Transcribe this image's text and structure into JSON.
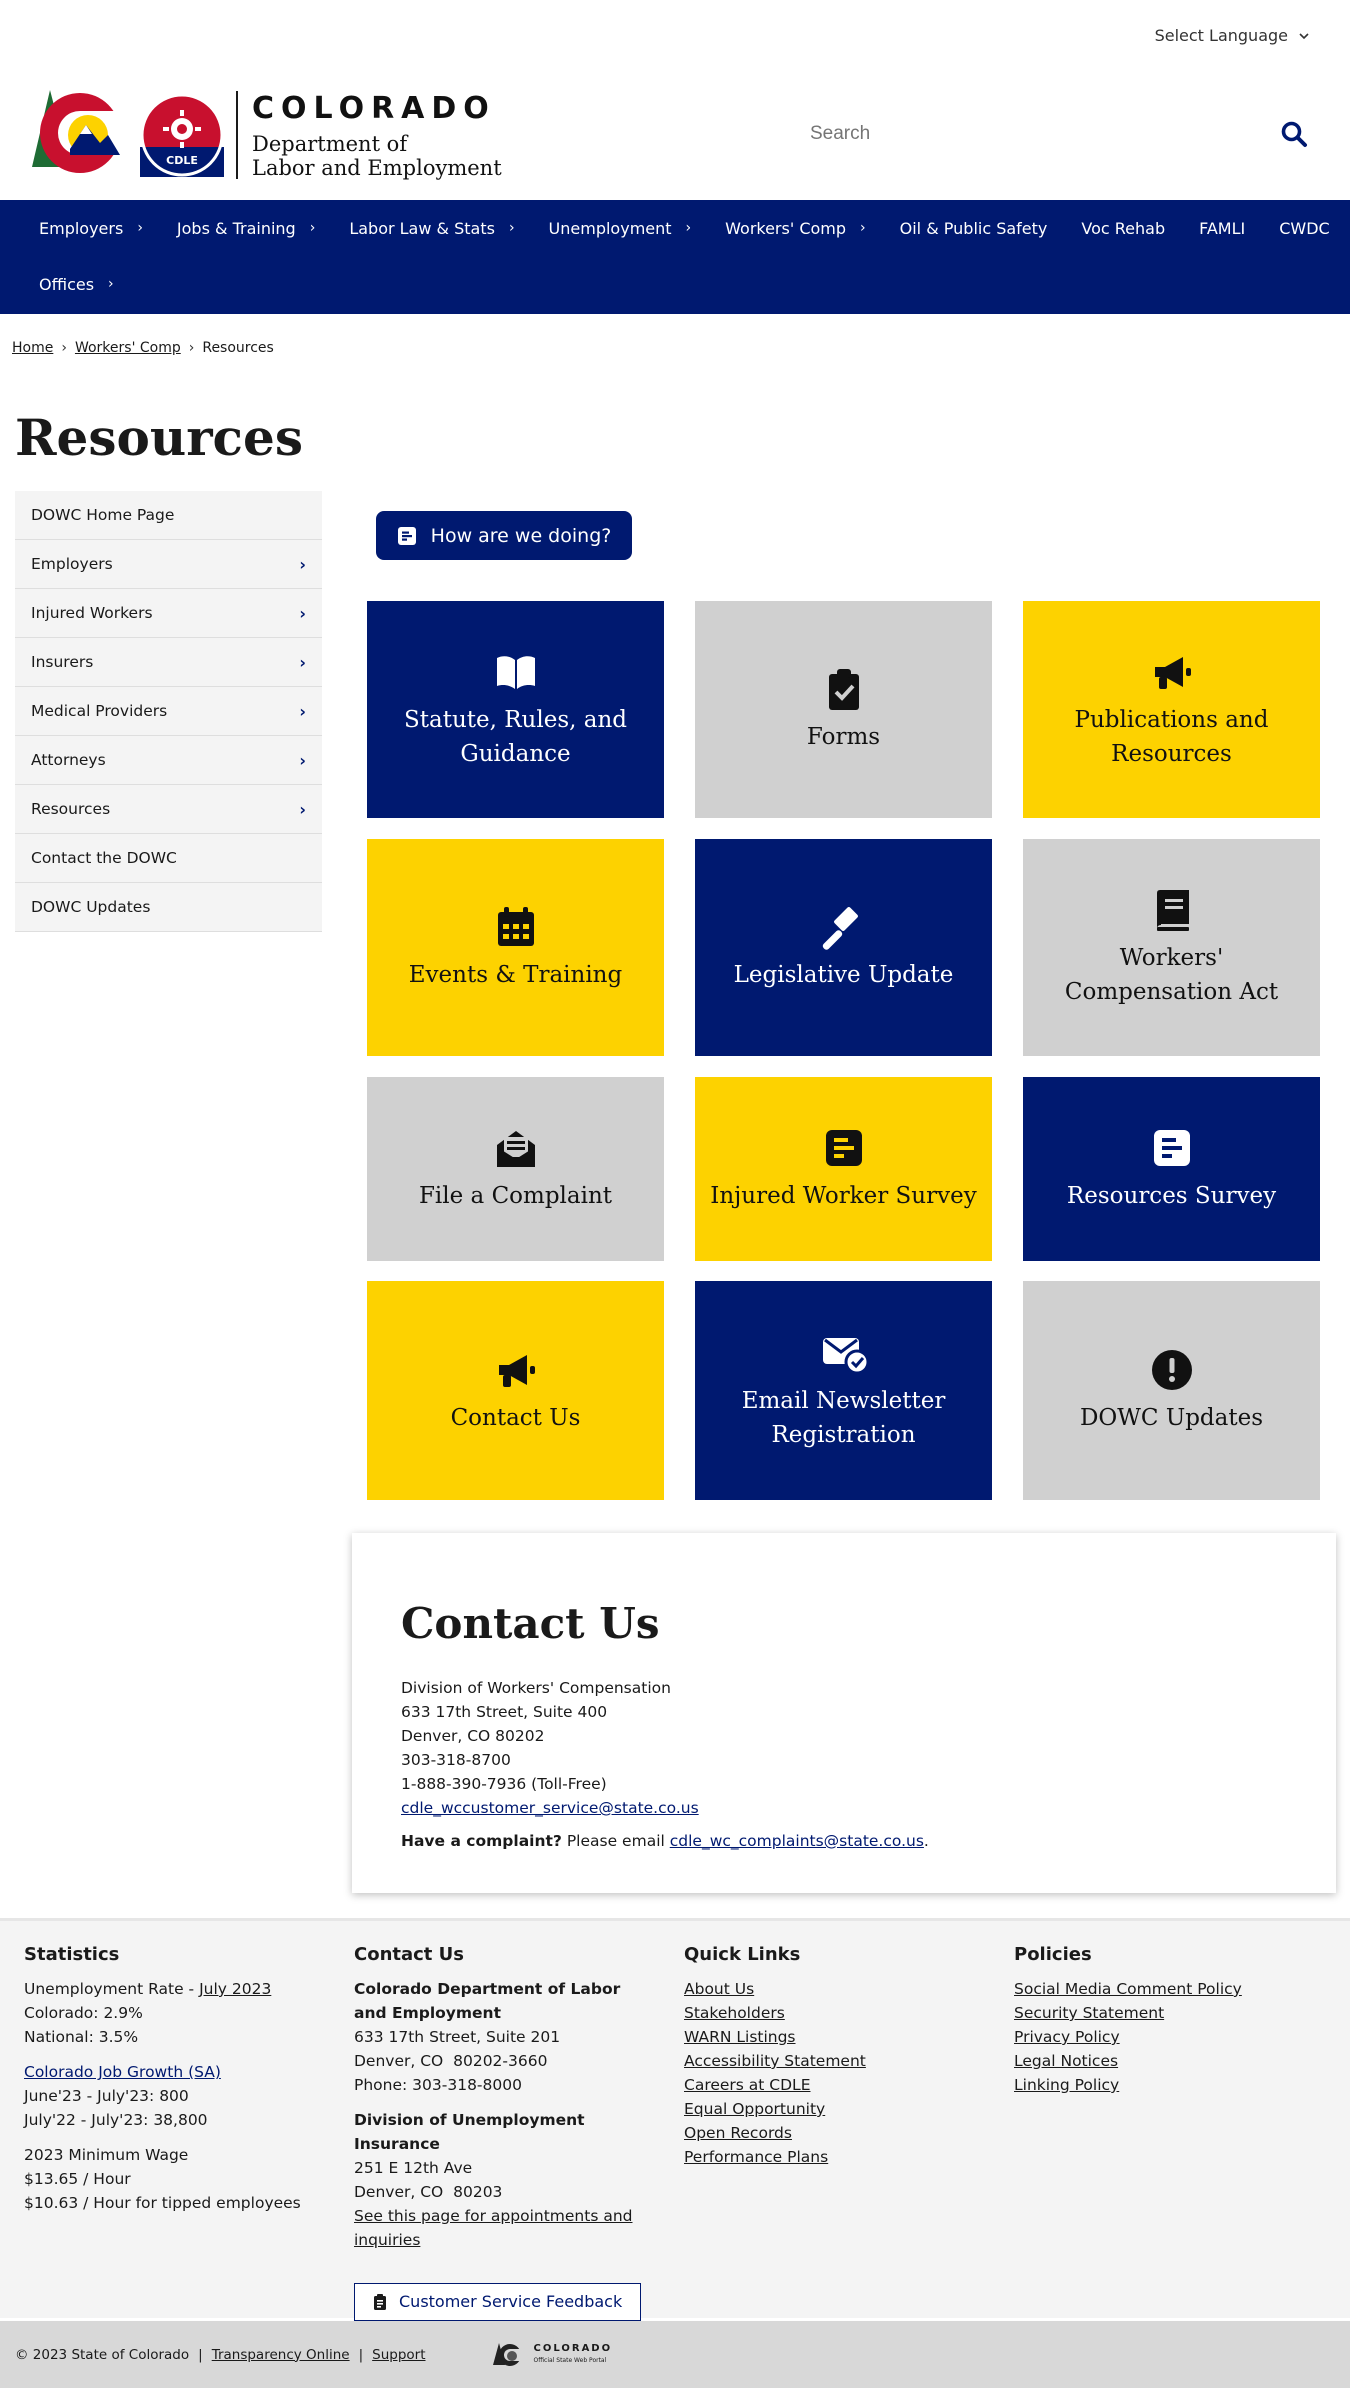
{
  "language": {
    "label": "Select Language"
  },
  "header": {
    "state": "COLORADO",
    "dept_line1": "Department of",
    "dept_line2": "Labor and Employment",
    "logo_badge": "CDLE",
    "search_placeholder": "Search"
  },
  "nav": {
    "row1": [
      {
        "label": "Employers",
        "has_children": true
      },
      {
        "label": "Jobs & Training",
        "has_children": true
      },
      {
        "label": "Labor Law & Stats",
        "has_children": true
      },
      {
        "label": "Unemployment",
        "has_children": true
      },
      {
        "label": "Workers' Comp",
        "has_children": true
      },
      {
        "label": "Oil & Public Safety",
        "has_children": false
      },
      {
        "label": "Voc Rehab",
        "has_children": false
      },
      {
        "label": "FAMLI",
        "has_children": false
      },
      {
        "label": "CWDC",
        "has_children": false
      }
    ],
    "row2": [
      {
        "label": "Offices",
        "has_children": true
      }
    ]
  },
  "breadcrumb": {
    "home": "Home",
    "section": "Workers' Comp",
    "current": "Resources",
    "separator": "›"
  },
  "page_title": "Resources",
  "sidebar": [
    {
      "label": "DOWC Home Page",
      "chevron": false
    },
    {
      "label": "Employers",
      "chevron": true
    },
    {
      "label": "Injured Workers",
      "chevron": true
    },
    {
      "label": "Insurers",
      "chevron": true
    },
    {
      "label": "Medical Providers",
      "chevron": true
    },
    {
      "label": "Attorneys",
      "chevron": true
    },
    {
      "label": "Resources",
      "chevron": true
    },
    {
      "label": "Contact the DOWC",
      "chevron": false
    },
    {
      "label": "DOWC Updates",
      "chevron": false
    }
  ],
  "feedback_button": "How are we doing?",
  "tiles": [
    {
      "label": "Statute, Rules, and Guidance",
      "color": "blue",
      "icon": "book-open-icon"
    },
    {
      "label": "Forms",
      "color": "grey",
      "icon": "clipboard-check-icon"
    },
    {
      "label": "Publications and Resources",
      "color": "yellow",
      "icon": "megaphone-icon"
    },
    {
      "label": "Events & Training",
      "color": "yellow",
      "icon": "calendar-icon"
    },
    {
      "label": "Legislative Update",
      "color": "blue",
      "icon": "gavel-icon"
    },
    {
      "label": "Workers' Compensation Act",
      "color": "grey",
      "icon": "book-icon"
    },
    {
      "label": "File a Complaint",
      "color": "grey",
      "icon": "envelope-open-icon"
    },
    {
      "label": "Injured Worker Survey",
      "color": "yellow",
      "icon": "survey-icon"
    },
    {
      "label": "Resources Survey",
      "color": "blue",
      "icon": "survey-icon"
    },
    {
      "label": "Contact Us",
      "color": "yellow",
      "icon": "megaphone-icon"
    },
    {
      "label": "Email Newsletter Registration",
      "color": "blue",
      "icon": "envelope-check-icon"
    },
    {
      "label": "DOWC Updates",
      "color": "grey",
      "icon": "exclamation-circle-icon"
    }
  ],
  "colors": {
    "navy": "#001970",
    "grey": "#d0d0d0",
    "yellow": "#fdd200"
  },
  "contact": {
    "heading": "Contact Us",
    "lines": [
      "Division of Workers' Compensation",
      "633 17th Street, Suite 400",
      "Denver, CO 80202",
      "303-318-8700",
      "1-888-390-7936 (Toll-Free)"
    ],
    "email": "cdle_wccustomer_service@state.co.us",
    "complaint_bold": "Have a complaint?",
    "complaint_text": " Please email ",
    "complaint_email": "cdle_wc_complaints@state.co.us",
    "complaint_end": "."
  },
  "footer": {
    "statistics": {
      "heading": "Statistics",
      "unemp_label": "Unemployment Rate - ",
      "unemp_link": "July 2023",
      "colorado": "Colorado: 2.9%",
      "national": "National: 3.5%",
      "growth_link": "Colorado Job Growth (SA)",
      "growth1": "June'23 - July'23: 800",
      "growth2": "July'22 - July'23: 38,800",
      "wage_title": "2023 Minimum Wage",
      "wage1": "$13.65 / Hour",
      "wage2": "$10.63 / Hour for tipped employees"
    },
    "contact": {
      "heading": "Contact Us",
      "org1": "Colorado Department of Labor and Employment",
      "addr1": "633 17th Street, Suite 201",
      "city1": "Denver, CO  80202-3660",
      "phone1": "Phone: 303-318-8000",
      "org2": "Division of Unemployment Insurance",
      "addr2": "251 E 12th Ave",
      "city2": "Denver, CO  80203",
      "appt_link": "See this page for appointments and inquiries",
      "feedback_button": "Customer Service Feedback"
    },
    "quick_links": {
      "heading": "Quick Links",
      "items": [
        "About Us",
        "Stakeholders",
        "WARN Listings",
        "Accessibility Statement",
        "Careers at CDLE",
        "Equal Opportunity",
        "Open Records",
        "Performance Plans"
      ]
    },
    "policies": {
      "heading": "Policies",
      "items": [
        "Social Media Comment Policy",
        "Security Statement",
        "Privacy Policy",
        "Legal Notices",
        "Linking Policy"
      ]
    }
  },
  "bottom": {
    "copyright": "© 2023 State of Colorado",
    "transparency": "Transparency Online",
    "support": "Support",
    "separator": "|",
    "portal_title": "COLORADO",
    "portal_sub": "Official State Web Portal"
  }
}
